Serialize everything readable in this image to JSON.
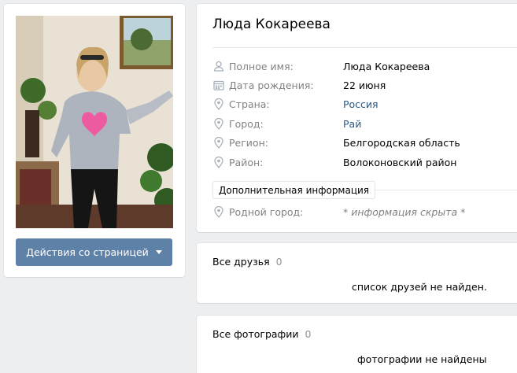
{
  "profile": {
    "name": "Люда Кокареева",
    "actions_button": "Действия со страницей"
  },
  "info": {
    "rows": [
      {
        "icon": "user-icon",
        "label": "Полное имя:",
        "value": "Люда Кокареева",
        "link": false
      },
      {
        "icon": "calendar-icon",
        "label": "Дата рождения:",
        "value": "22 июня",
        "link": false
      },
      {
        "icon": "location-icon",
        "label": "Страна:",
        "value": "Россия",
        "link": true
      },
      {
        "icon": "location-icon",
        "label": "Город:",
        "value": "Рай",
        "link": true
      },
      {
        "icon": "location-icon",
        "label": "Регион:",
        "value": "Белгородская область",
        "link": false
      },
      {
        "icon": "location-icon",
        "label": "Район:",
        "value": "Волоконовский район",
        "link": false
      }
    ],
    "more_button": "Дополнительная информация",
    "hometown": {
      "icon": "location-icon",
      "label": "Родной город:",
      "value": "* информация скрыта *"
    }
  },
  "friends": {
    "title": "Все друзья",
    "count": "0",
    "empty": "список друзей не найден."
  },
  "photos": {
    "title": "Все фотографии",
    "count": "0",
    "empty": "фотографии не найдены"
  },
  "colors": {
    "accent_button": "#5e81a8",
    "link": "#2a5885",
    "muted": "#828282"
  }
}
